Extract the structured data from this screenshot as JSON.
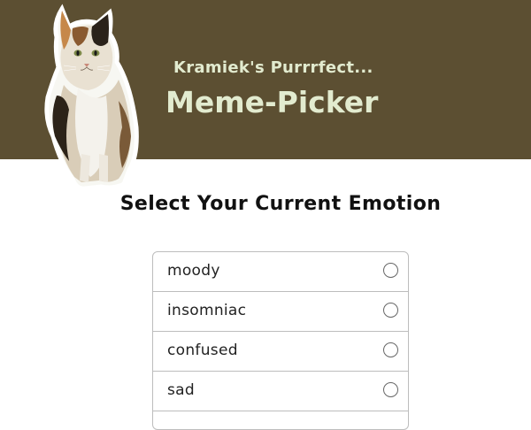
{
  "header": {
    "subtitle": "Kramiek's Purrrfect...",
    "title": "Meme-Picker",
    "background_color": "#5c4f32",
    "text_color": "#e2ebcf",
    "logo_icon": "calico-cat-icon"
  },
  "main": {
    "prompt": "Select Your Current Emotion",
    "emotions": [
      {
        "label": "moody",
        "selected": false
      },
      {
        "label": "insomniac",
        "selected": false
      },
      {
        "label": "confused",
        "selected": false
      },
      {
        "label": "sad",
        "selected": false
      }
    ]
  }
}
